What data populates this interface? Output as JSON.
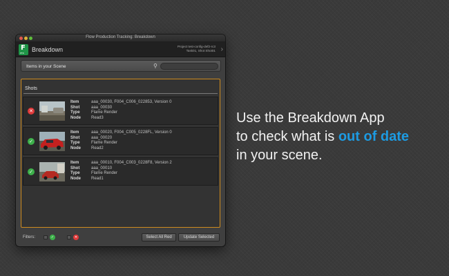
{
  "window": {
    "title": "Flow Production Tracking: Breakdown"
  },
  "header": {
    "logo_letter": "F",
    "logo_sub": "PTR",
    "app_name": "Breakdown",
    "context_line1": "Project test-config-def2-rc3",
    "context_line2": "Task01, Shot Shot01"
  },
  "search": {
    "label": "Items in your Scene",
    "placeholder": "",
    "value": ""
  },
  "section": {
    "title": "Shots"
  },
  "field_labels": [
    "Item",
    "Shot",
    "Type",
    "Node"
  ],
  "items": [
    {
      "status": "out-of-date",
      "status_color": "#e03a3a",
      "status_glyph": "✕",
      "item": "aaa_00030, F004_C006_022853, Version 0",
      "shot": "aaa_00030",
      "type": "Flame Render",
      "node": "Read3"
    },
    {
      "status": "up-to-date",
      "status_color": "#3db04a",
      "status_glyph": "✓",
      "item": "aaa_00020, F004_C005_0228FL, Version 0",
      "shot": "aaa_00020",
      "type": "Flame Render",
      "node": "Read2"
    },
    {
      "status": "up-to-date",
      "status_color": "#3db04a",
      "status_glyph": "✓",
      "item": "aaa_00010, F004_C003_0228F8, Version 2",
      "shot": "aaa_00010",
      "type": "Flame Render",
      "node": "Read1"
    }
  ],
  "footer": {
    "filters_label": "Filters:",
    "select_red_label": "Select All Red",
    "update_label": "Update Selected"
  },
  "promo": {
    "line1": "Use the Breakdown App",
    "line2_prefix": "to check what is ",
    "line2_accent": "out of date",
    "line3": "in your scene."
  },
  "colors": {
    "accent": "#1d9be2",
    "panel_border": "#d08c1e",
    "ok": "#3db04a",
    "bad": "#e03a3a"
  }
}
